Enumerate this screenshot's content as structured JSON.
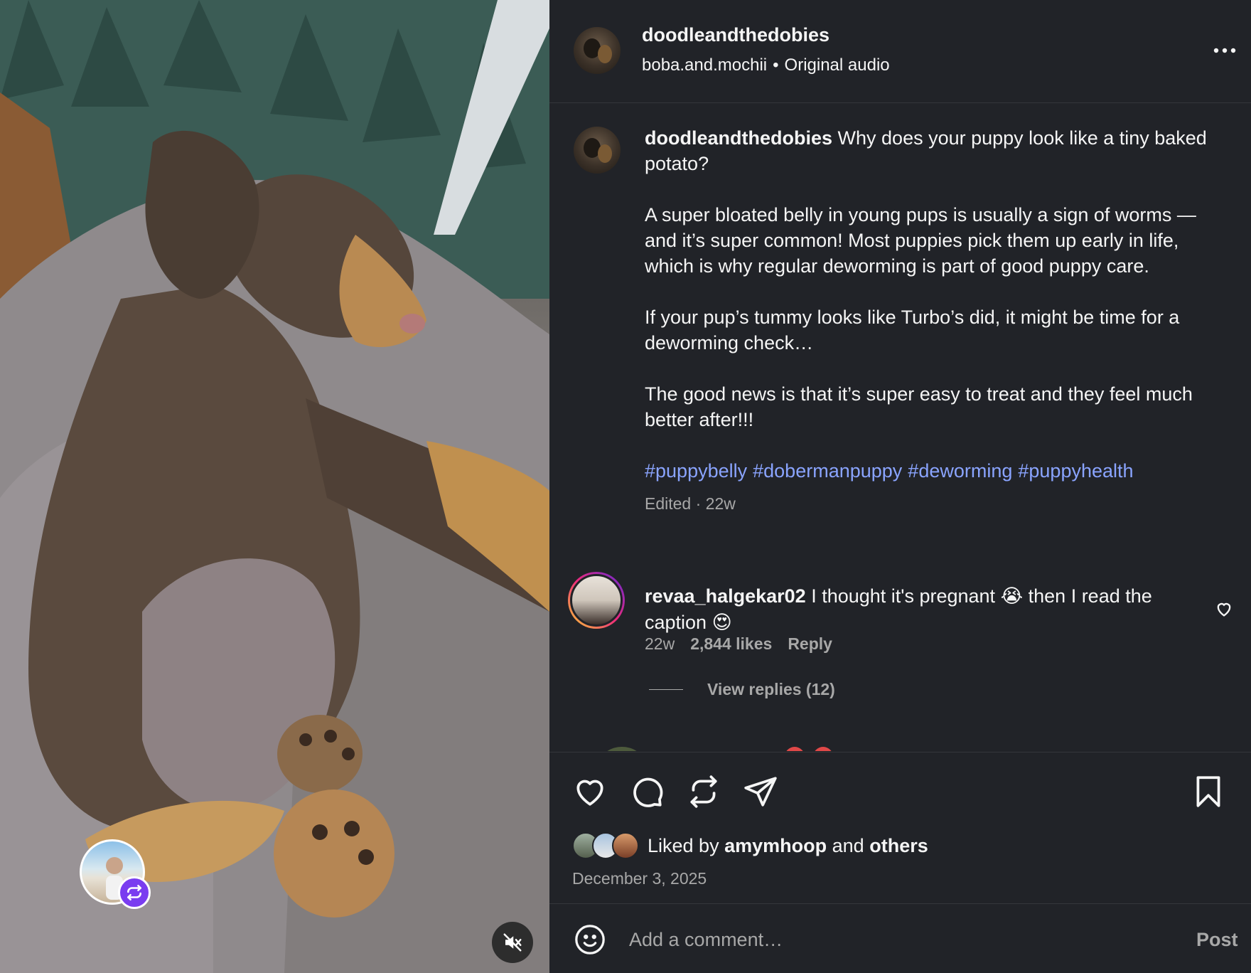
{
  "header": {
    "username": "doodleandthedobies",
    "audio_user": "boba.and.mochii",
    "separator": "•",
    "audio_label": "Original audio"
  },
  "caption": {
    "username": "doodleandthedobies",
    "first_line": "Why does your puppy look like a tiny baked potato?",
    "para2": "A super bloated belly in young pups is usually a sign of worms — and it’s super common! Most puppies pick them up early in life, which is why regular deworming is part of good puppy care.",
    "para3": "If your pup’s tummy looks like Turbo’s did, it might be time for a deworming check…",
    "para4": "The good news is that it’s super easy to treat and they feel much better after!!!",
    "hashtags": [
      "#puppybelly",
      "#dobermanpuppy",
      "#deworming",
      "#puppyhealth"
    ],
    "meta": "Edited · 22w"
  },
  "comment": {
    "username": "revaa_halgekar02",
    "text_part1": "I thought it's pregnant",
    "emoji1": "😭",
    "text_part2": "then I read the caption",
    "emoji2": "😍",
    "time": "22w",
    "likes": "2,844 likes",
    "reply_label": "Reply",
    "view_replies": "View replies (12)"
  },
  "liked_by": {
    "prefix": "Liked by",
    "user": "amymhoop",
    "conjunction": "and",
    "others": "others"
  },
  "date": "December 3, 2025",
  "add_comment": {
    "placeholder": "Add a comment…",
    "post_label": "Post"
  },
  "colors": {
    "panel_bg": "#212328",
    "hashtag": "#8aa4ff",
    "muted_text": "#a8a8a8",
    "remix_badge": "#7a3df0"
  },
  "icons": {
    "header_more": "more-horizontal-icon",
    "like": "heart-icon",
    "comment": "comment-bubble-icon",
    "repost": "repost-icon",
    "share": "send-icon",
    "save": "bookmark-icon",
    "mute": "speaker-muted-icon",
    "emoji": "smiley-icon"
  }
}
